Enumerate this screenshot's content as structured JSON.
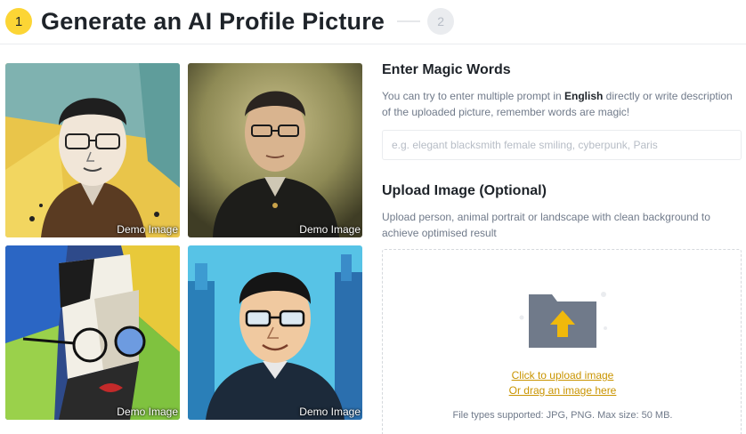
{
  "header": {
    "active_step": "1",
    "title": "Generate an AI Profile Picture",
    "next_step": "2"
  },
  "gallery": {
    "demo_label": "Demo Image"
  },
  "magic_words": {
    "title": "Enter Magic Words",
    "description_before": "You can try to enter multiple prompt in ",
    "description_bold": "English",
    "description_after": " directly or write description of the uploaded picture, remember words are magic!",
    "placeholder": "e.g. elegant blacksmith female smiling, cyberpunk, Paris",
    "value": ""
  },
  "upload": {
    "title": "Upload Image (Optional)",
    "description": "Upload person, animal portrait or landscape with clean background to achieve optimised result",
    "click_link": "Click to upload image",
    "drag_link": "Or drag an image here",
    "file_types": "File types supported: JPG, PNG. Max size: 50 MB."
  },
  "colors": {
    "accent": "#fcd535",
    "link": "#c99400",
    "text_primary": "#1e2329",
    "text_secondary": "#707a8a"
  }
}
